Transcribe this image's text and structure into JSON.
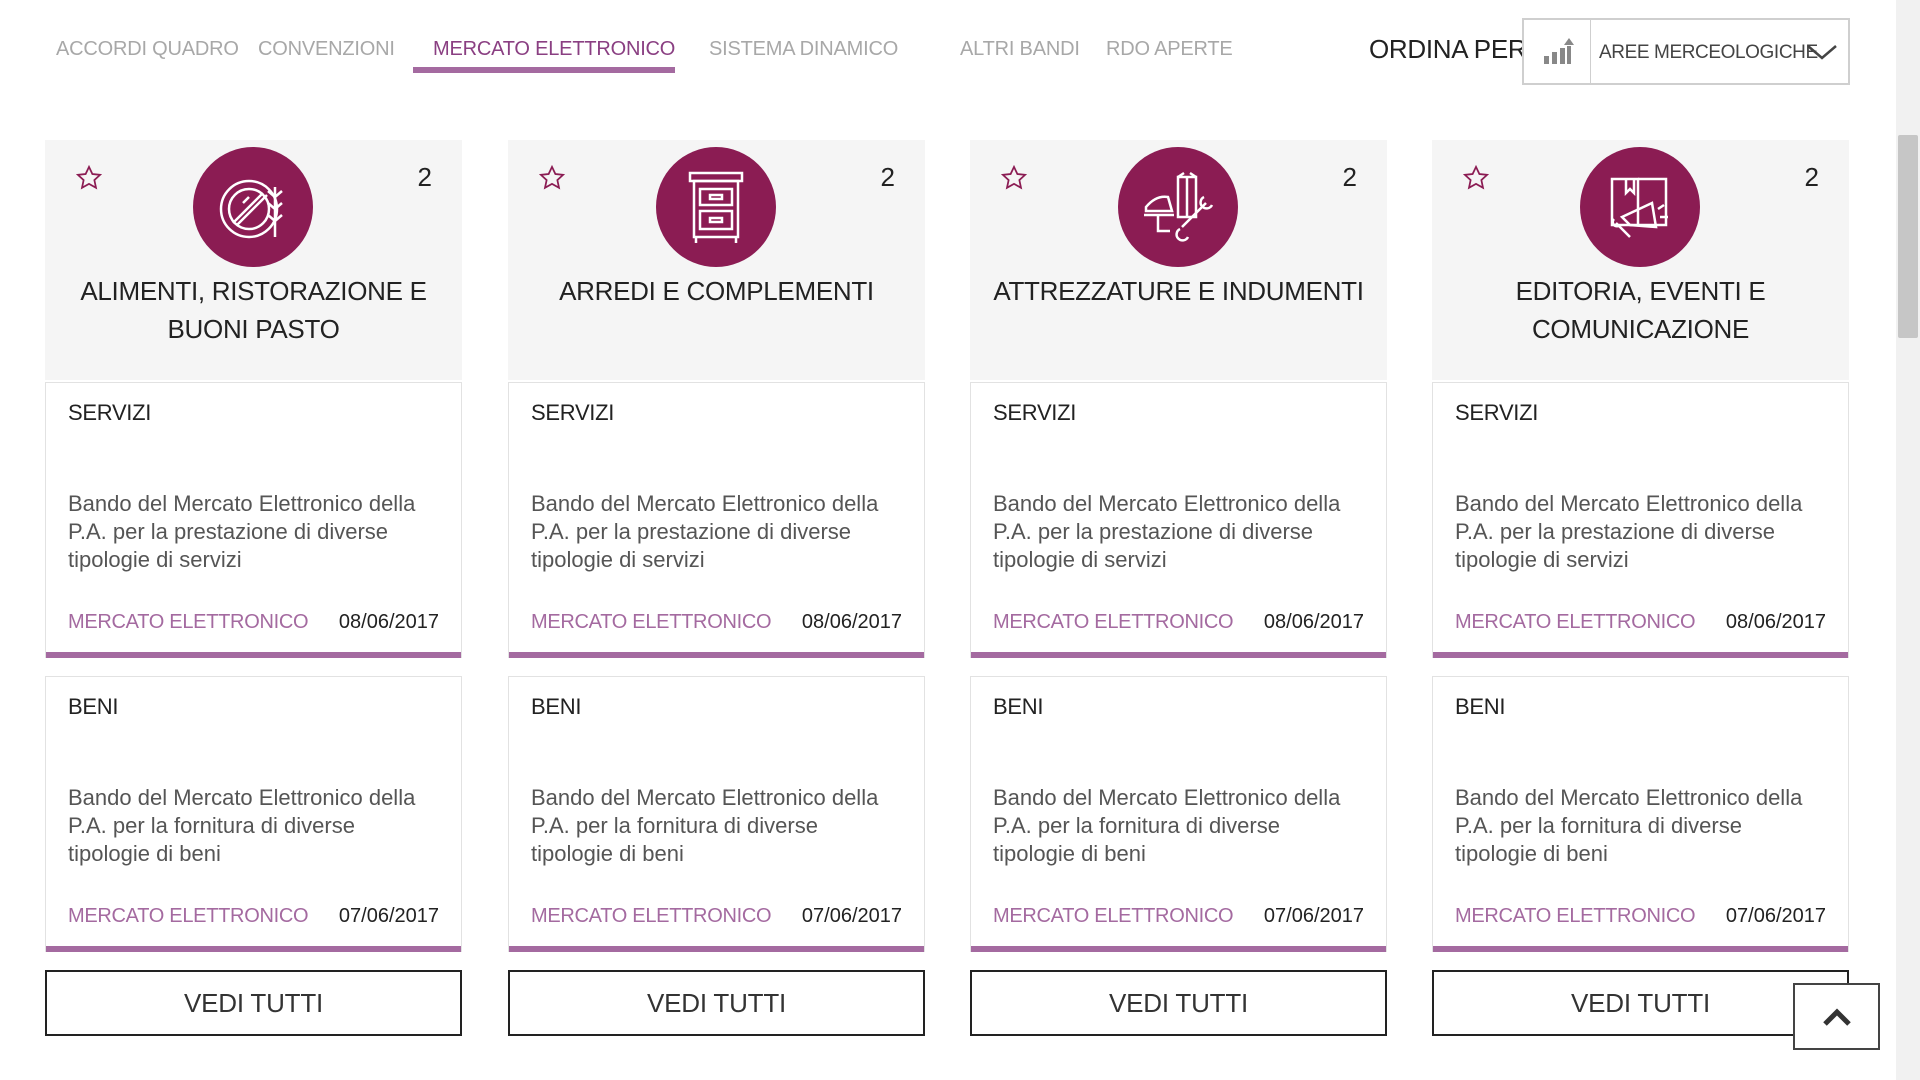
{
  "tabs": [
    {
      "label": "ACCORDI QUADRO"
    },
    {
      "label": "CONVENZIONI"
    },
    {
      "label": "MERCATO ELETTRONICO"
    },
    {
      "label": "SISTEMA DINAMICO"
    },
    {
      "label": "ALTRI BANDI"
    },
    {
      "label": "RDO APERTE"
    }
  ],
  "active_tab": "MERCATO ELETTRONICO",
  "sort": {
    "label": "ORDINA PER",
    "value": "AREE MERCEOLOGICHE",
    "icon": "bar-chart-up-icon"
  },
  "colors": {
    "accent": "#a46aa0",
    "brand": "#8b1c53",
    "active_tab": "#8a3f82"
  },
  "cards": [
    {
      "title": "ALIMENTI, RISTORAZIONE E BUONI PASTO",
      "count": "2",
      "icon": "food-icon",
      "items": [
        {
          "type": "SERVIZI",
          "desc": "Bando del Mercato Elettronico della P.A. per la prestazione di diverse tipologie di servizi",
          "category": "MERCATO ELETTRONICO",
          "date": "08/06/2017"
        },
        {
          "type": "BENI",
          "desc": "Bando del Mercato Elettronico della P.A. per la fornitura di diverse tipologie di beni",
          "category": "MERCATO ELETTRONICO",
          "date": "07/06/2017"
        }
      ],
      "button": "VEDI TUTTI"
    },
    {
      "title": "ARREDI E COMPLEMENTI",
      "count": "2",
      "icon": "furniture-icon",
      "items": [
        {
          "type": "SERVIZI",
          "desc": "Bando del Mercato Elettronico della P.A. per la prestazione di diverse tipologie di servizi",
          "category": "MERCATO ELETTRONICO",
          "date": "08/06/2017"
        },
        {
          "type": "BENI",
          "desc": "Bando del Mercato Elettronico della P.A. per la fornitura di diverse tipologie di beni",
          "category": "MERCATO ELETTRONICO",
          "date": "07/06/2017"
        }
      ],
      "button": "VEDI TUTTI"
    },
    {
      "title": "ATTREZZATURE E INDUMENTI",
      "count": "2",
      "icon": "tools-icon",
      "items": [
        {
          "type": "SERVIZI",
          "desc": "Bando del Mercato Elettronico della P.A. per la prestazione di diverse tipologie di servizi",
          "category": "MERCATO ELETTRONICO",
          "date": "08/06/2017"
        },
        {
          "type": "BENI",
          "desc": "Bando del Mercato Elettronico della P.A. per la fornitura di diverse tipologie di beni",
          "category": "MERCATO ELETTRONICO",
          "date": "07/06/2017"
        }
      ],
      "button": "VEDI TUTTI"
    },
    {
      "title": "EDITORIA, EVENTI E COMUNICAZIONE",
      "count": "2",
      "icon": "book-megaphone-icon",
      "items": [
        {
          "type": "SERVIZI",
          "desc": "Bando del Mercato Elettronico della P.A. per la prestazione di diverse tipologie di servizi",
          "category": "MERCATO ELETTRONICO",
          "date": "08/06/2017"
        },
        {
          "type": "BENI",
          "desc": "Bando del Mercato Elettronico della P.A. per la fornitura di diverse tipologie di beni",
          "category": "MERCATO ELETTRONICO",
          "date": "07/06/2017"
        }
      ],
      "button": "VEDI TUTTI"
    }
  ],
  "back_to_top_icon": "chevron-up-icon"
}
